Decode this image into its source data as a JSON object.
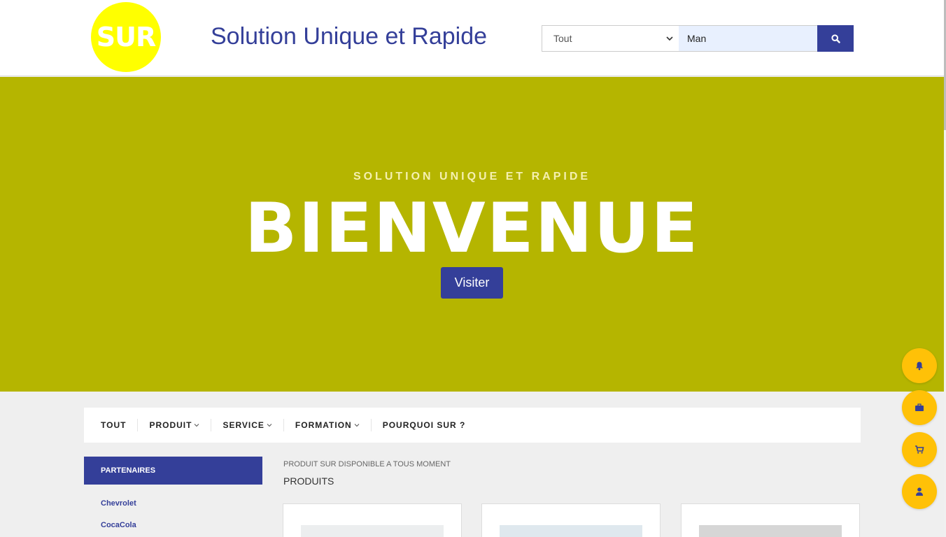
{
  "header": {
    "logo_text": "SUR",
    "site_title": "Solution Unique et Rapide",
    "search": {
      "category_selected": "Tout",
      "query_value": "Man"
    }
  },
  "hero": {
    "subtitle": "SOLUTION UNIQUE ET RAPIDE",
    "title": "BIENVENUE",
    "button_label": "Visiter"
  },
  "nav": {
    "items": [
      {
        "label": "TOUT"
      },
      {
        "label": "PRODUIT"
      },
      {
        "label": "SERVICE"
      },
      {
        "label": "FORMATION"
      },
      {
        "label": "POURQUOI SUR ?"
      }
    ]
  },
  "sidebar": {
    "heading": "PARTENAIRES",
    "links": [
      {
        "label": "Chevrolet"
      },
      {
        "label": "CocaCola"
      }
    ]
  },
  "content": {
    "subtitle": "PRODUIT SUR DISPONIBLE A TOUS MOMENT",
    "title": "PRODUITS"
  },
  "floating_buttons": [
    "bell-icon",
    "briefcase-icon",
    "cart-icon",
    "user-icon"
  ],
  "colors": {
    "brand_blue": "#343f99",
    "hero_olive": "#b5b500",
    "logo_yellow": "#ffff00",
    "fab_amber": "#ffc107"
  }
}
